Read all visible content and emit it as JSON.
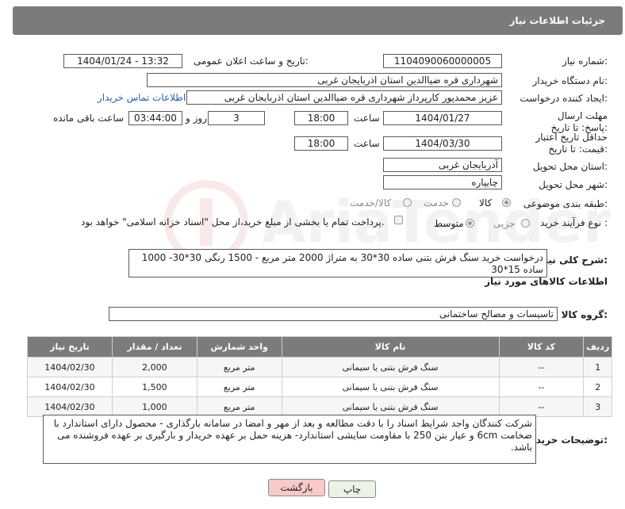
{
  "header": {
    "title": "جزئیات اطلاعات نیاز"
  },
  "form": {
    "need_number_label": "شماره نیاز:",
    "need_number": "1104090060000005",
    "announce_label": "تاریخ و ساعت اعلان عمومی:",
    "announce_value": "1404/01/24 - 13:32",
    "buyer_org_label": "نام دستگاه خریدار:",
    "buyer_org": "شهرداری قره ضیاالدین استان اذربایجان غربی",
    "creator_label": "ایجاد کننده درخواست:",
    "creator": "عزیز محمدپور کارپرداز شهرداری قره ضیاالدین استان اذربایجان غربی",
    "contact_link": "اطلاعات تماس خریدار",
    "send_deadline_label": "مهلت ارسال پاسخ: تا تاریخ:",
    "send_date": "1404/01/27",
    "time_label": "ساعت",
    "send_time": "18:00",
    "days_value": "3",
    "days_label": "روز و",
    "remaining_time": "03:44:00",
    "remaining_label": "ساعت باقی مانده",
    "price_deadline_label": "حداقل تاریخ اعتبار قیمت: تا تاریخ:",
    "price_date": "1404/03/30",
    "price_time": "18:00",
    "province_label": "استان محل تحویل:",
    "province": "آذربایجان غربی",
    "city_label": "شهر محل تحویل:",
    "city": "چایپاره",
    "category_label": "طبقه بندی موضوعی:",
    "category_options": [
      "کالا",
      "خدمت",
      "کالا/خدمت"
    ],
    "process_label": "نوع فرآیند خرید :",
    "process_options": [
      "جزیی",
      "متوسط"
    ],
    "payment_note": "پرداخت تمام یا بخشی از مبلغ خرید،از محل \"اسناد خزانه اسلامی\" خواهد بود.",
    "summary_label": "شرح کلی نیاز:",
    "summary": "درخواست خرید سنگ فرش بتنی ساده 30*30 به متراژ 2000 متر مربع - 1500 رنگی 30*30- 1000 ساده 15*30",
    "goods_info_title": "اطلاعات کالاهای مورد نیاز",
    "group_label": "گروه کالا:",
    "group_value": "تاسیسات و مصالح ساختمانی"
  },
  "table": {
    "headers": [
      "ردیف",
      "کد کالا",
      "نام کالا",
      "واحد شمارش",
      "تعداد / مقدار",
      "تاریخ نیاز"
    ],
    "rows": [
      [
        "1",
        "--",
        "سنگ فرش بتنی یا سیمانی",
        "متر مربع",
        "2,000",
        "1404/02/30"
      ],
      [
        "2",
        "--",
        "سنگ فرش بتنی یا سیمانی",
        "متر مربع",
        "1,500",
        "1404/02/30"
      ],
      [
        "3",
        "--",
        "سنگ فرش بتنی یا سیمانی",
        "متر مربع",
        "1,000",
        "1404/02/30"
      ]
    ]
  },
  "notes": {
    "label": "توضیحات خریدار:",
    "text": "شرکت کنندگان واجد شرایط اسناد را با دقت مطالعه و بعد از مهر و امضا در سامانه بارگذاری - محصول دارای استاندارد با ضخامت 6cm و عیار بتن 250 با مقاومت سایشی استاندارد- هزینه حمل بر عهده خریدار و بارگیری بر عهده فروشنده می باشد."
  },
  "buttons": {
    "print": "چاپ",
    "back": "بازگشت"
  },
  "colors": {
    "header_bg": "#7b7b7b",
    "link": "#2a5db0",
    "back_btn_bg": "#f7c9c9",
    "print_btn_bg": "#eaf3e4"
  }
}
